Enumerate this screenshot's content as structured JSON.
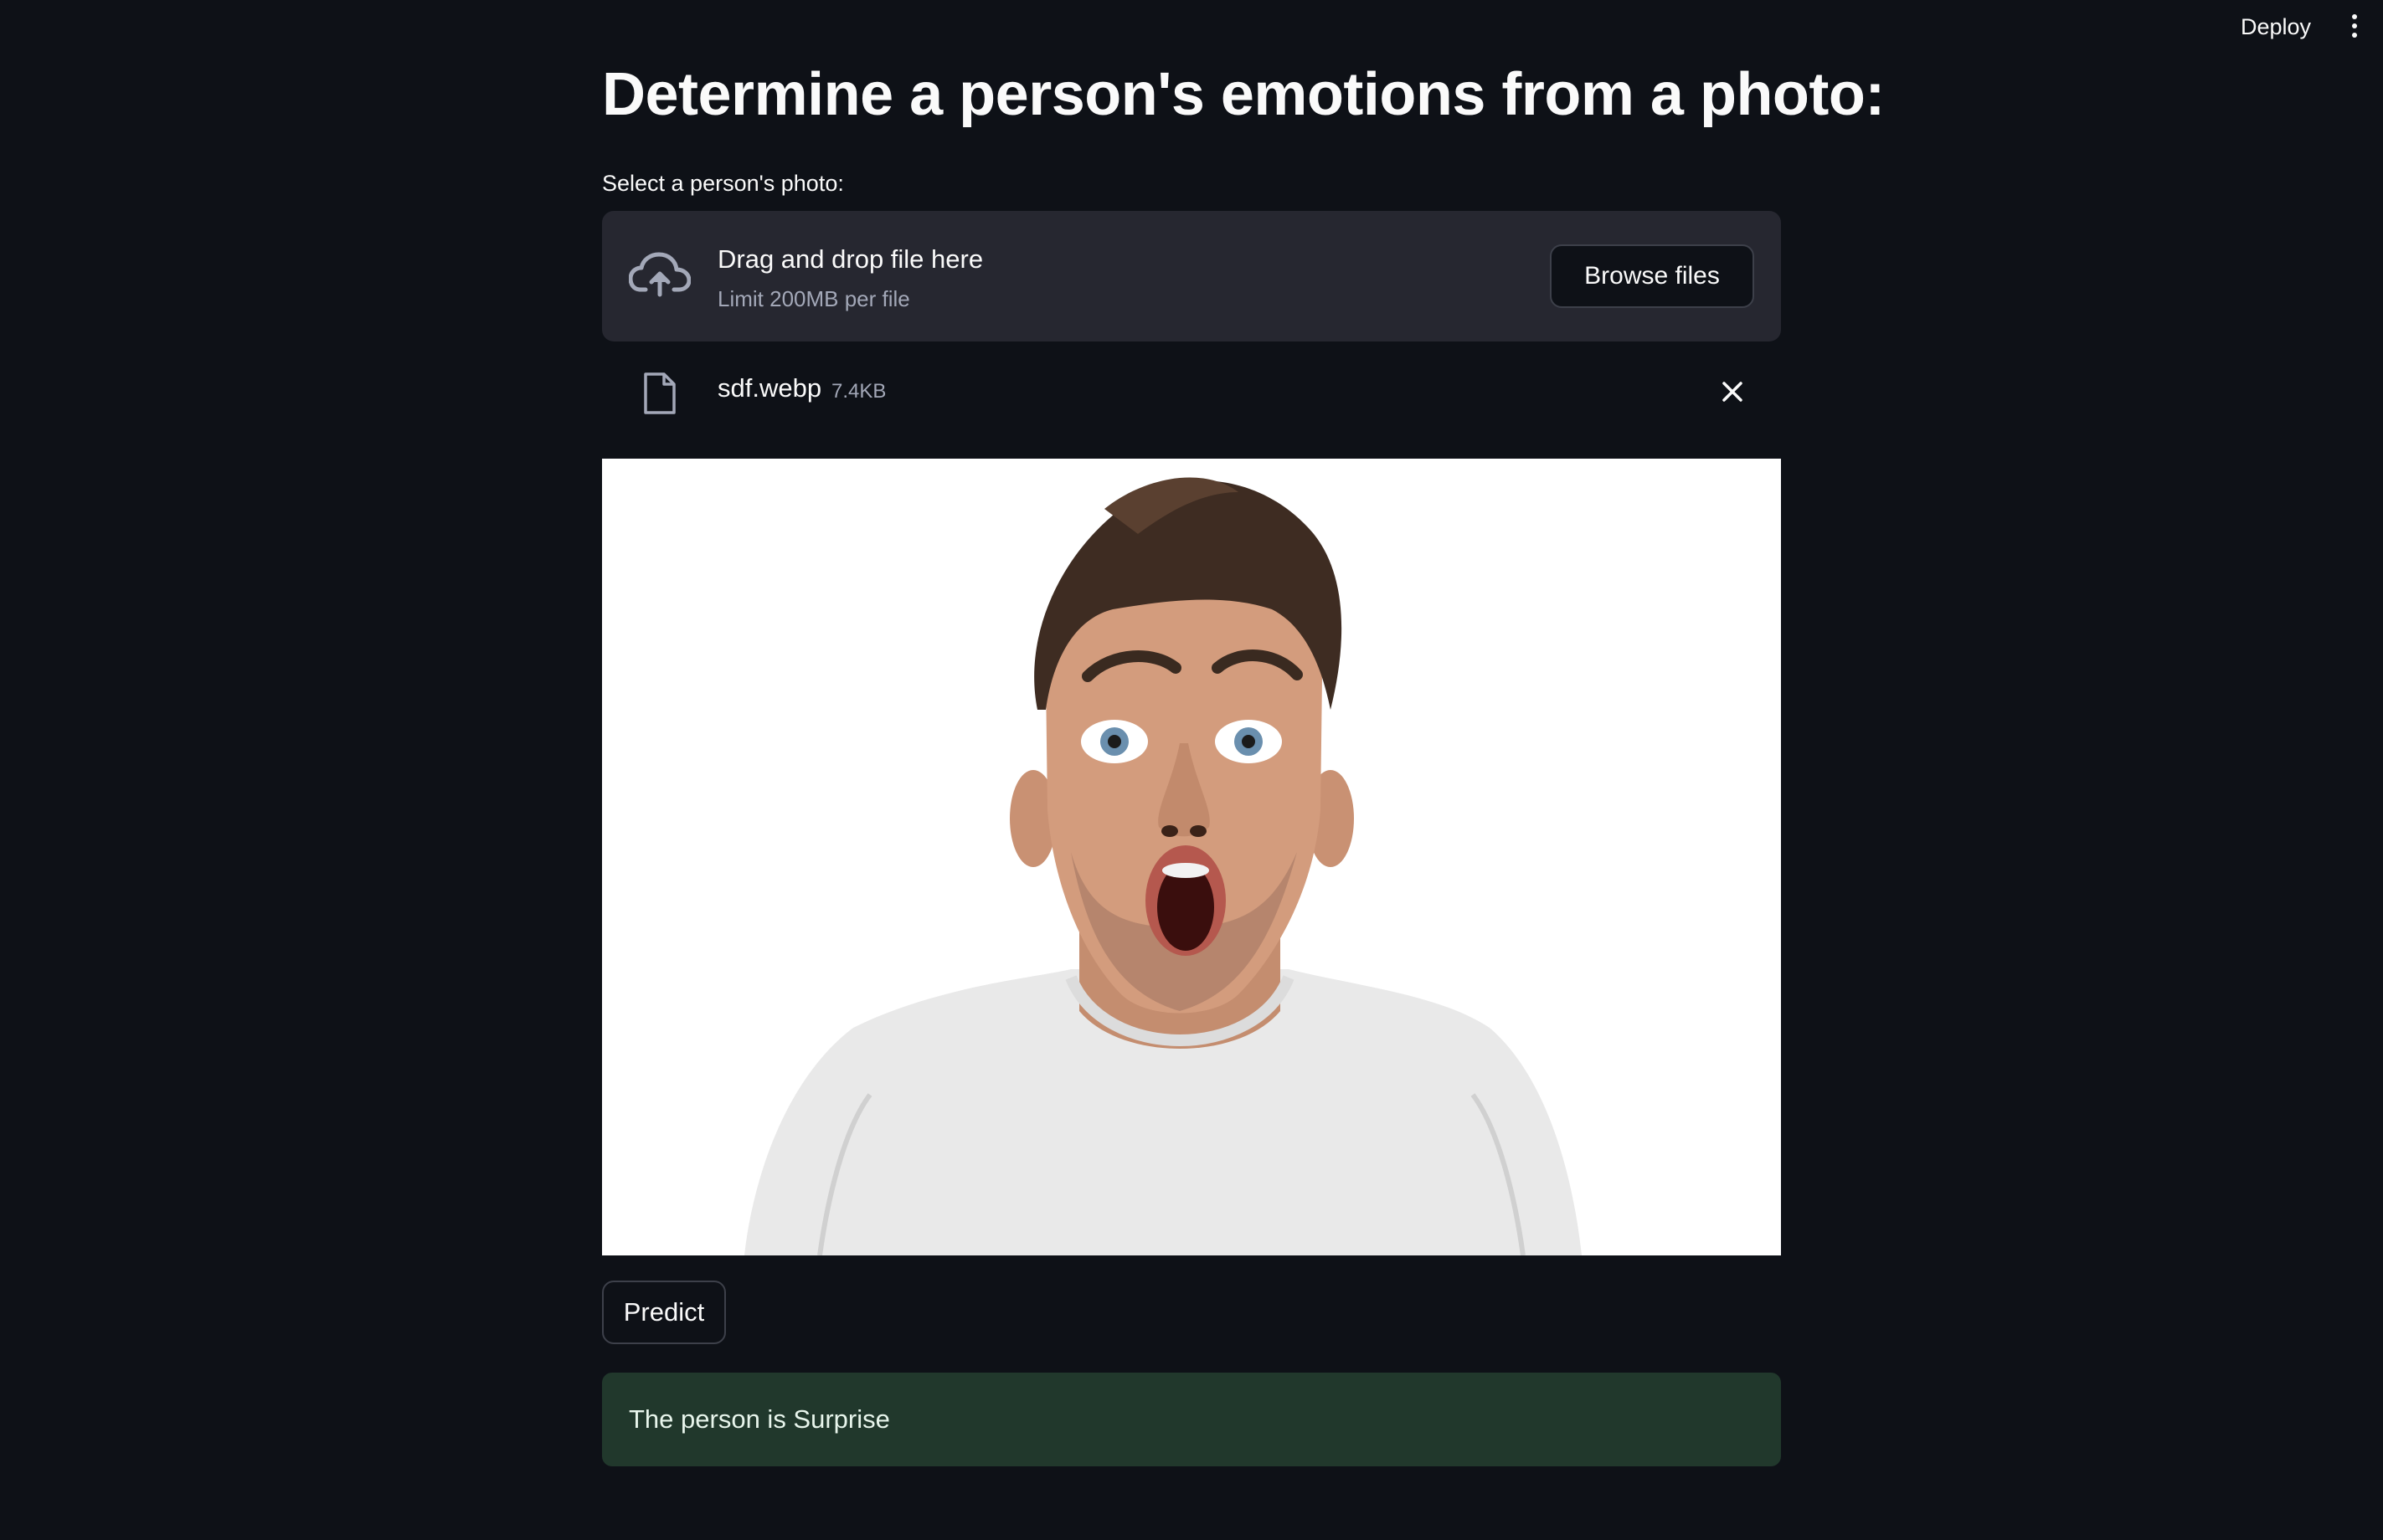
{
  "header": {
    "deploy_label": "Deploy",
    "menu_icon": "kebab-menu-icon"
  },
  "page_title": "Determine a person's emotions from a photo:",
  "uploader": {
    "label": "Select a person's photo:",
    "dropzone_title": "Drag and drop file here",
    "limit_text": "Limit 200MB per file",
    "browse_label": "Browse files",
    "upload_icon": "cloud-upload-icon"
  },
  "uploaded_file": {
    "name": "sdf.webp",
    "size": "7.4KB",
    "file_icon": "file-icon",
    "remove_icon": "close-icon"
  },
  "image": {
    "subject": "man-with-surprised-expression"
  },
  "predict_label": "Predict",
  "result_text": "The person is Surprise",
  "colors": {
    "background": "#0e1117",
    "dropzone": "#262730",
    "success_bg": "#21382c",
    "text": "#fafafa",
    "muted": "#a3a8b8"
  }
}
